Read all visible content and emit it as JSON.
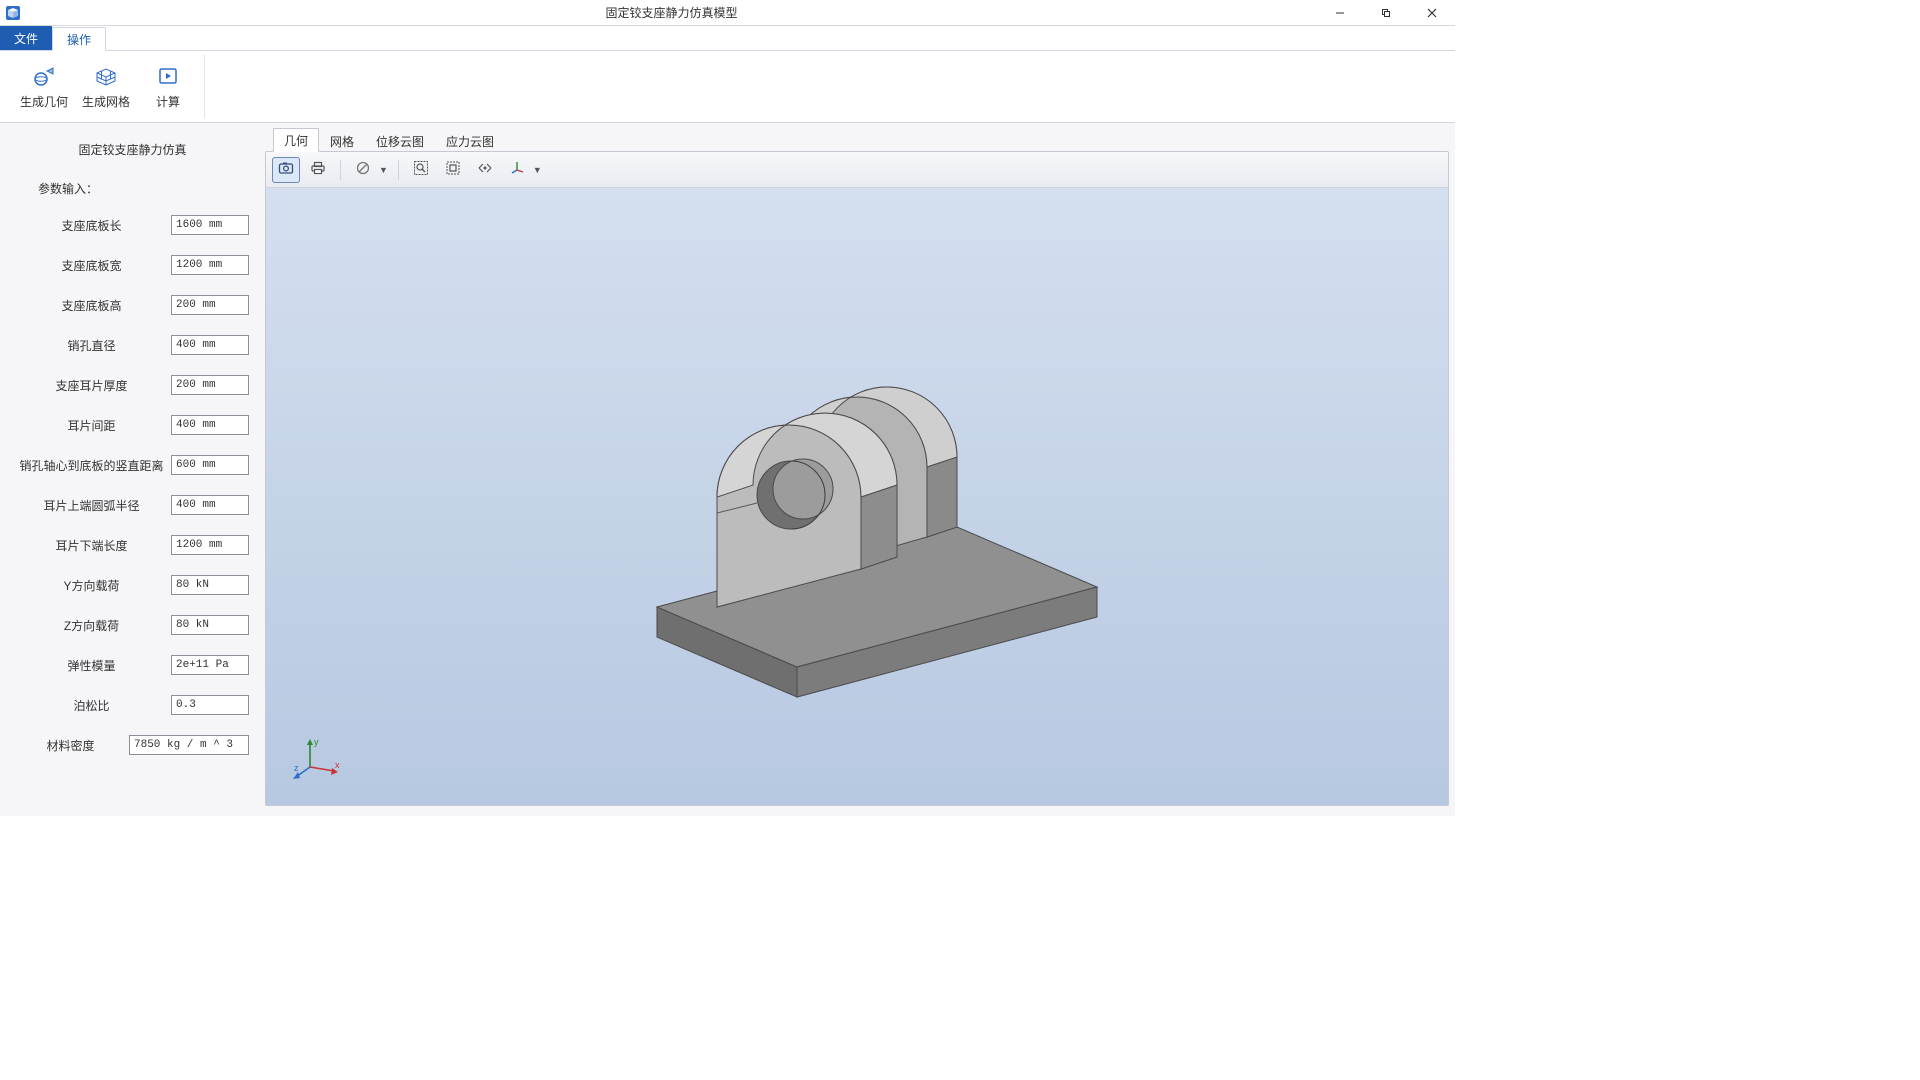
{
  "window": {
    "title": "固定铰支座静力仿真模型"
  },
  "ribbon": {
    "tabs": {
      "file": "文件",
      "operate": "操作"
    },
    "buttons": {
      "gen_geometry": "生成几何",
      "gen_mesh": "生成网格",
      "compute": "计算"
    }
  },
  "sidebar": {
    "title": "固定铰支座静力仿真",
    "subtitle": "参数输入：",
    "params": {
      "base_length": {
        "label": "支座底板长",
        "value": "1600 mm"
      },
      "base_width": {
        "label": "支座底板宽",
        "value": "1200 mm"
      },
      "base_height": {
        "label": "支座底板高",
        "value": "200 mm"
      },
      "pin_diameter": {
        "label": "销孔直径",
        "value": "400 mm"
      },
      "ear_thickness": {
        "label": "支座耳片厚度",
        "value": "200 mm"
      },
      "ear_gap": {
        "label": "耳片间距",
        "value": "400 mm"
      },
      "pin_to_base": {
        "label": "销孔轴心到底板的竖直距离",
        "value": "600 mm"
      },
      "ear_arc_r": {
        "label": "耳片上端圆弧半径",
        "value": "400 mm"
      },
      "ear_bottom_l": {
        "label": "耳片下端长度",
        "value": "1200 mm"
      },
      "load_y": {
        "label": "Y方向载荷",
        "value": "80 kN"
      },
      "load_z": {
        "label": "Z方向载荷",
        "value": "80 kN"
      },
      "elastic_mod": {
        "label": "弹性模量",
        "value": "2e+11 Pa"
      },
      "poisson": {
        "label": "泊松比",
        "value": "0.3"
      },
      "density": {
        "label": "材料密度",
        "value": "7850 kg / m ^ 3"
      }
    }
  },
  "view_tabs": {
    "geometry": "几何",
    "mesh": "网格",
    "displacement": "位移云图",
    "stress": "应力云图"
  },
  "triad": {
    "x": "x",
    "y": "y",
    "z": "z"
  }
}
